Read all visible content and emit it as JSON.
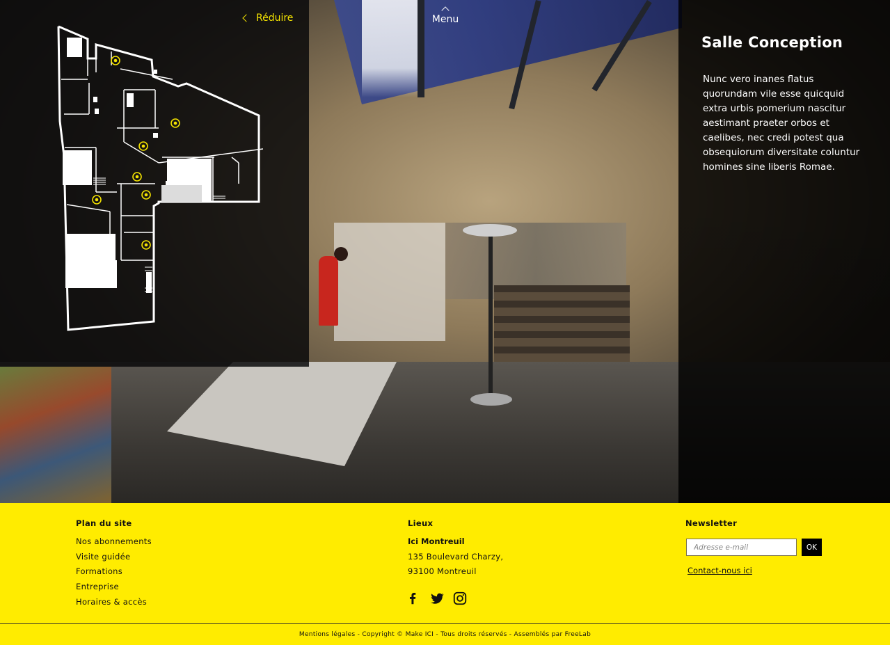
{
  "header": {
    "reduce_label": "Réduire",
    "menu_label": "Menu"
  },
  "room": {
    "title": "Salle Conception",
    "description": "Nunc vero inanes flatus quorundam vile esse quicquid extra urbis pomerium nascitur aestimant praeter orbos et caelibes, nec credi potest qua obsequiorum diversitate coluntur homines sine liberis Romae."
  },
  "floorplan": {
    "marker_count": 7,
    "marker_color": "#f5e400"
  },
  "footer": {
    "sitemap": {
      "title": "Plan du site",
      "links": [
        "Nos abonnements",
        "Visite guidée",
        "Formations",
        "Entreprise",
        "Horaires & accès"
      ]
    },
    "places": {
      "title": "Lieux",
      "name": "Ici Montreuil",
      "address_line1": "135 Boulevard Charzy,",
      "address_line2": "93100 Montreuil",
      "socials": [
        "facebook-icon",
        "twitter-icon",
        "instagram-icon"
      ]
    },
    "newsletter": {
      "title": "Newsletter",
      "email_placeholder": "Adresse e-mail",
      "ok_label": "OK",
      "contact_label": "Contact-nous ici"
    },
    "bottom_text": "Mentions légales - Copyright © Make ICI - Tous droits réservés - Assemblés par FreeLab",
    "background_color": "#ffec00"
  },
  "colors": {
    "accent": "#f5e400",
    "panel_dark": "#000000"
  }
}
